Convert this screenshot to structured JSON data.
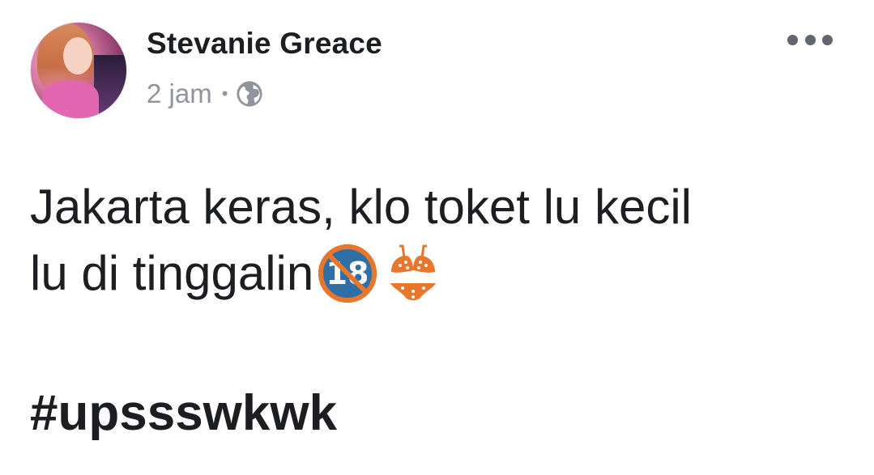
{
  "post": {
    "author": "Stevanie Greace",
    "time": "2 jam",
    "separator": "•",
    "privacy_icon": "globe-icon",
    "more_icon": "more-horizontal-icon",
    "text_line1": "Jakarta keras, klo toket lu kecil",
    "text_line2": "lu di tinggalin",
    "emoji_1": "no-one-under-eighteen-emoji",
    "emoji_1_text": "18",
    "emoji_2": "bikini-emoji",
    "hashtag": "#upssswkwk"
  },
  "colors": {
    "text": "#1c1e21",
    "meta": "#90949c",
    "emoji_orange": "#e8762d",
    "emoji_blue": "#2f6fa6"
  }
}
